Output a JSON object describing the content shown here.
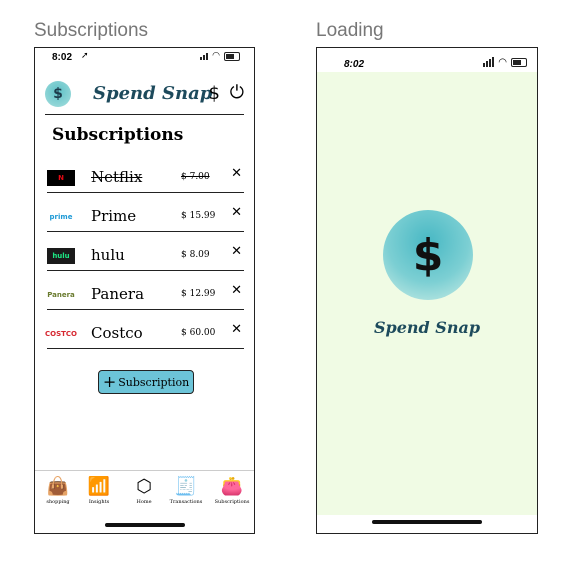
{
  "frames": {
    "subscriptions_label": "Subscriptions",
    "loading_label": "Loading"
  },
  "status_bar": {
    "time1": "8:02",
    "time2": "8:02"
  },
  "header": {
    "brand": "Spend Snap",
    "logo_glyph": "$",
    "dollar_glyph": "$",
    "power_glyph": "⏻"
  },
  "page_title": "Subscriptions",
  "subscriptions": [
    {
      "name": "Netflix",
      "price": "$ 7.00",
      "logo": "N",
      "logo_bg": "#000000",
      "logo_color": "#e50914",
      "cancelled": true,
      "remove": "✕"
    },
    {
      "name": "Prime",
      "price": "$ 15.99",
      "logo": "prime",
      "logo_bg": "#ffffff",
      "logo_color": "#1f9ad6",
      "cancelled": false,
      "remove": "✕"
    },
    {
      "name": "hulu",
      "price": "$ 8.09",
      "logo": "hulu",
      "logo_bg": "#1a1a1a",
      "logo_color": "#1ce783",
      "cancelled": false,
      "remove": "✕"
    },
    {
      "name": "Panera",
      "price": "$ 12.99",
      "logo": "Panera",
      "logo_bg": "#ffffff",
      "logo_color": "#6a7b2f",
      "cancelled": false,
      "remove": "✕"
    },
    {
      "name": "Costco",
      "price": "$ 60.00",
      "logo": "COSTCO",
      "logo_bg": "#ffffff",
      "logo_color": "#d6262f",
      "cancelled": false,
      "remove": "✕"
    }
  ],
  "add_button": {
    "plus": "+",
    "label": "Subscription"
  },
  "tabs": [
    {
      "label": "shopping",
      "icon": "shopping-bag-icon",
      "glyph": "👜"
    },
    {
      "label": "Insights",
      "icon": "bar-chart-icon",
      "glyph": "📶"
    },
    {
      "label": "Home",
      "icon": "cube-icon",
      "glyph": "⬡"
    },
    {
      "label": "Transactions",
      "icon": "receipt-icon",
      "glyph": "🧾"
    },
    {
      "label": "Subscriptions",
      "icon": "wallet-icon",
      "glyph": "👛"
    }
  ],
  "loading": {
    "brand": "Spend Snap",
    "logo_glyph": "$"
  },
  "colors": {
    "accent": "#6cc4d8",
    "brand_text": "#1d4a5c",
    "loading_bg": "#f0fbe4"
  }
}
